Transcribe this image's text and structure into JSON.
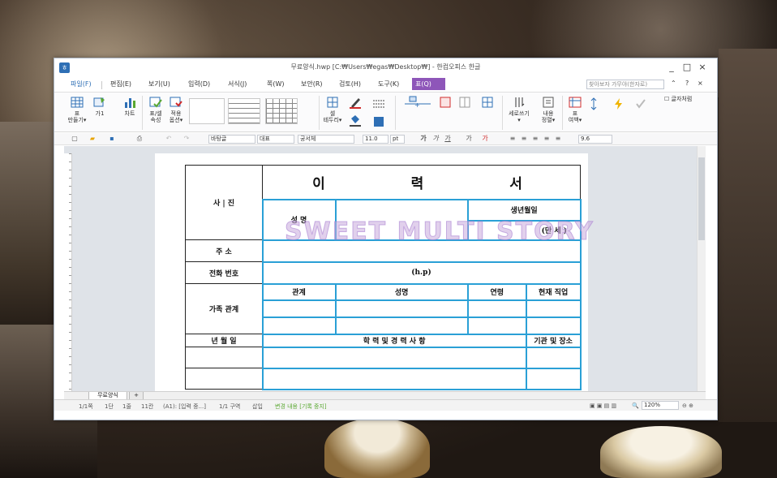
{
  "window": {
    "title": "무료양식.hwp [C:₩Users₩egas₩Desktop₩] - 한컴오피스 한글",
    "controls": [
      "_",
      "□",
      "×"
    ]
  },
  "menu": {
    "items": [
      "파일(F)",
      "편집(E)",
      "보기(U)",
      "입력(D)",
      "서식(J)",
      "쪽(W)",
      "보안(R)",
      "검토(H)",
      "도구(K)",
      "표(Q)"
    ],
    "help_placeholder": "찾아보자 가무야(한자로)"
  },
  "ribbon": {
    "buttons": [
      "표\n만들기",
      "차트",
      "표/셀\n속성",
      "적용\n옵션",
      "셀\n테두리",
      "세로쓰기",
      "내용\n정렬",
      "표\n여백",
      "글자처럼"
    ],
    "labels": {
      "make_table": "표",
      "make_table2": "만들기",
      "chart": "차트",
      "table_cell": "표/셀",
      "table_cell2": "속성",
      "apply": "적용",
      "apply2": "옵션",
      "cell": "셀",
      "border": "테두리",
      "vertical": "세로쓰기",
      "content": "내용",
      "align": "정렬",
      "table_margin": "표",
      "margin": "여백",
      "like_char": "글자처럼",
      "gal": "가1"
    }
  },
  "toolbar": {
    "style": "바탕글",
    "font_group": "대표",
    "font": "궁서체",
    "size": "11.0",
    "unit": "pt",
    "spacing": "9.6"
  },
  "document": {
    "title": "이 력 서",
    "watermark": "SWEET MULTI STORY",
    "photo": "사 | 진",
    "name": "성 명",
    "birth": "생년월일",
    "age": "(만   세 )",
    "address": "주    소",
    "phone": "전화 번호",
    "hp": "(h.p)",
    "family": "가족 관계",
    "family_headers": [
      "관계",
      "성명",
      "연령",
      "현재 직업"
    ],
    "date_label": "년    월    일",
    "education": "학 력  및  경 력 사 항",
    "institution": "기관 및 장소"
  },
  "tabs": {
    "doc_tab": "무료양식",
    "add": "+"
  },
  "status": {
    "page": "1/1쪽",
    "column": "1단",
    "line": "1줄",
    "col": "11칸",
    "cell": "(A1): [입력 중...]",
    "section": "1/1 구역",
    "mode": "삽입",
    "track": "변경 내용 [기록 중지]",
    "zoom": "120%"
  },
  "colors": {
    "menu_active": "#8e56b9",
    "selection": "#2aa0d6",
    "watermark": "#c8aadc"
  }
}
